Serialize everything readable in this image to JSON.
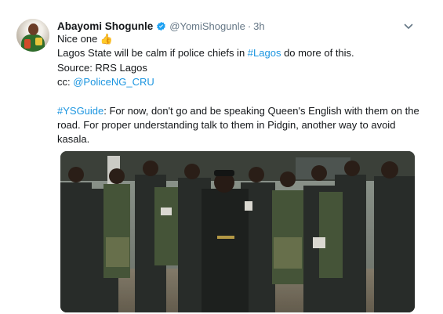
{
  "tweet": {
    "display_name": "Abayomi Shogunle",
    "handle": "@YomiShogunle",
    "separator": "·",
    "time": "3h",
    "line1_text": "Nice one ",
    "line1_emoji": "👍",
    "line2_prefix": "Lagos State will be calm if police chiefs in ",
    "line2_hashtag": "#Lagos",
    "line2_suffix": " do more of this.",
    "line3": "Source: RRS Lagos",
    "line4_prefix": "cc: ",
    "line4_mention": "@PoliceNG_CRU",
    "guide_hashtag": "#YSGuide",
    "guide_text": ": For now, don't go and be speaking Queen's English with them on the road. For proper understanding talk to them in Pidgin, another way to avoid kasala."
  },
  "icons": {
    "verified": "verified-badge-icon",
    "more": "chevron-down-icon"
  },
  "colors": {
    "link": "#1b95e0",
    "verified": "#1da1f2",
    "secondary_text": "#657786"
  }
}
